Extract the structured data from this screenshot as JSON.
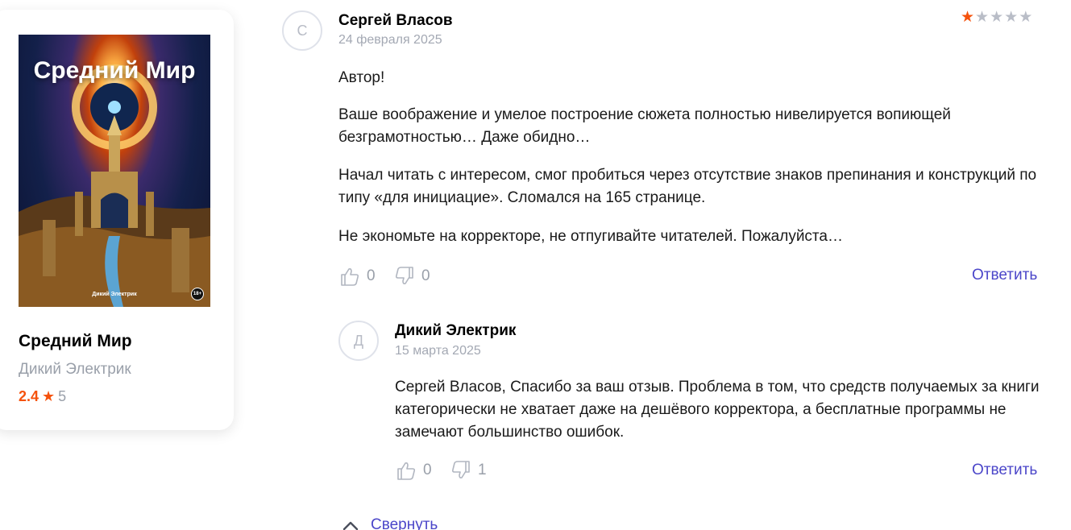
{
  "book": {
    "cover_title": "Средний Мир",
    "cover_author": "Дикий Электрик",
    "age_badge": "18+",
    "title": "Средний Мир",
    "author": "Дикий Электрик",
    "rating": "2.4",
    "rating_count": "5"
  },
  "review": {
    "author_initial": "С",
    "author": "Сергей Власов",
    "date": "24 февраля 2025",
    "stars_filled": 1,
    "stars_total": 5,
    "paragraphs": [
      "Автор!",
      "Ваше воображение и умелое построение сюжета полностью нивелируется вопиющей безграмотностью… Даже обидно…",
      "Начал читать с интересом, смог пробиться через отсутствие знаков препинания и конструкций по типу «для инициацие». Сломался на 165 странице.",
      "Не экономьте на корректоре, не отпугивайте читателей. Пожалуйста…"
    ],
    "likes": "0",
    "dislikes": "0",
    "reply_label": "Ответить"
  },
  "reply": {
    "author_initial": "Д",
    "author": "Дикий Электрик",
    "date": "15 марта 2025",
    "text": "Сергей Власов, Спасибо за ваш отзыв. Проблема в том, что средств получаемых за книги категорически не хватает даже на дешёвого корректора, а бесплатные программы не замечают большинство ошибок.",
    "likes": "0",
    "dislikes": "1",
    "reply_label": "Ответить"
  },
  "collapse_label": "Свернуть",
  "colors": {
    "accent_orange": "#f5520c",
    "link_blue": "#4b46c9",
    "muted_gray": "#9aa0aa"
  }
}
